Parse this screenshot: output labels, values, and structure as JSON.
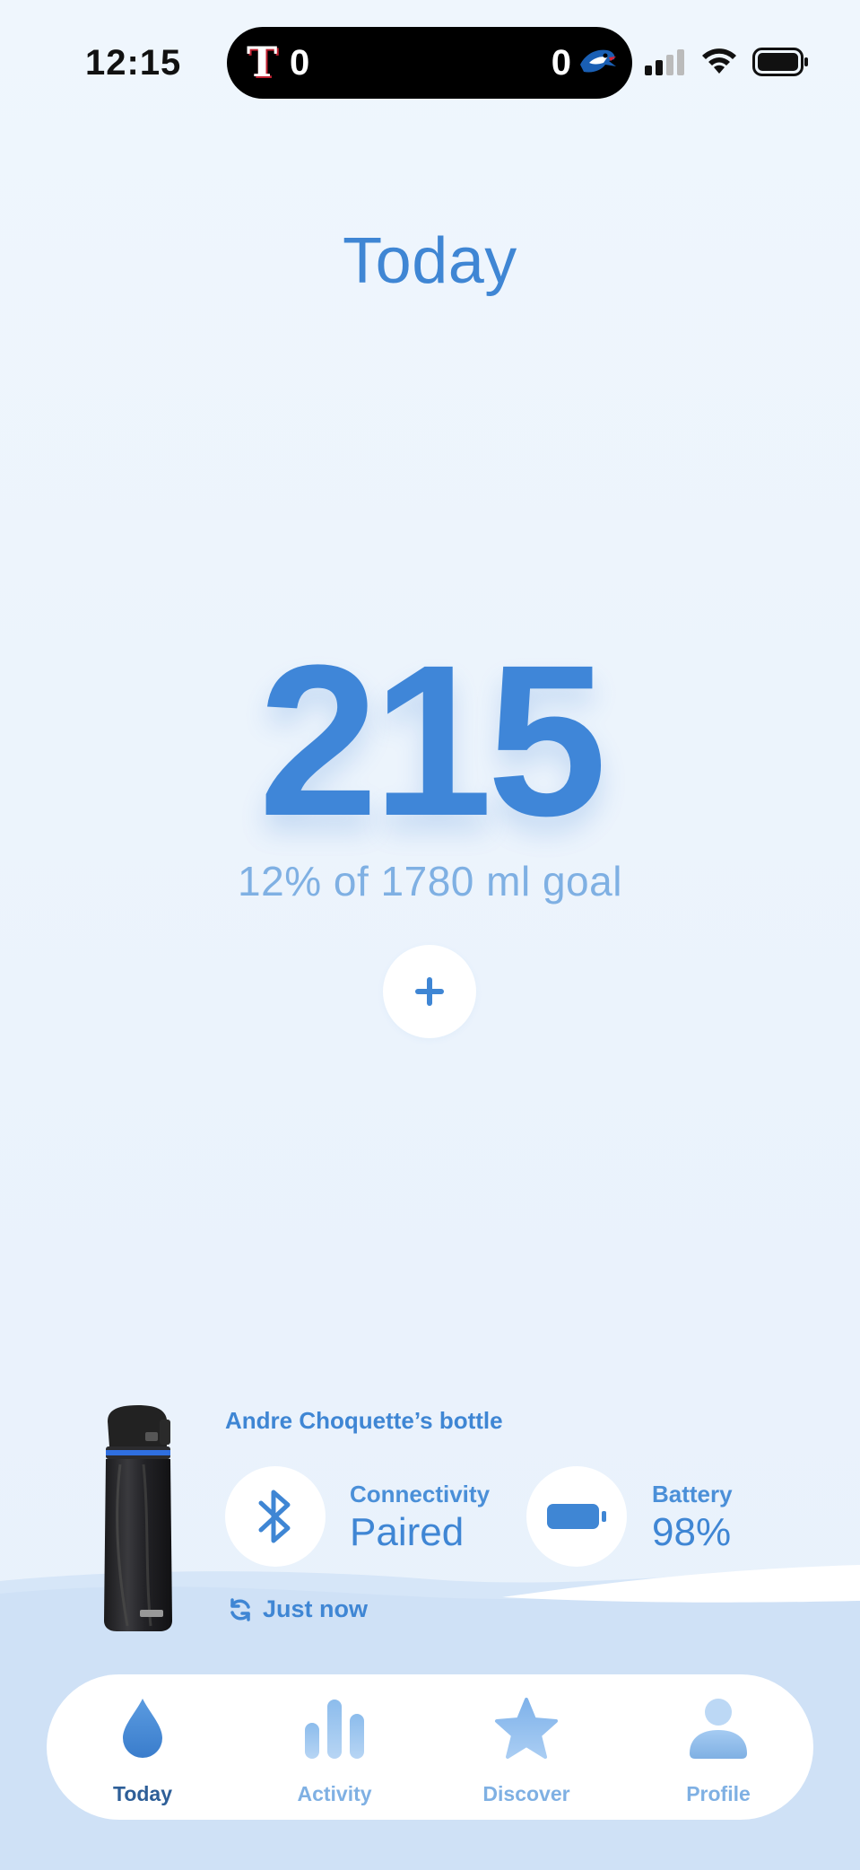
{
  "status_bar": {
    "time": "12:15",
    "live_activity": {
      "home_score": "0",
      "away_score": "0"
    }
  },
  "header": {
    "title": "Today"
  },
  "intake": {
    "value": "215",
    "goal_text": "12% of 1780 ml goal",
    "add_button_icon": "plus-icon"
  },
  "bottle": {
    "owner": "Andre Choquette’s bottle",
    "connectivity_label": "Connectivity",
    "connectivity_value": "Paired",
    "battery_label": "Battery",
    "battery_value": "98%",
    "sync_text": "Just now"
  },
  "tabs": [
    {
      "label": "Today",
      "icon": "water-drop-icon",
      "active": true
    },
    {
      "label": "Activity",
      "icon": "bar-chart-icon",
      "active": false
    },
    {
      "label": "Discover",
      "icon": "star-icon",
      "active": false
    },
    {
      "label": "Profile",
      "icon": "person-icon",
      "active": false
    }
  ],
  "colors": {
    "accent": "#3f86d4",
    "accent_light": "#7fb0e3",
    "active_tab": "#2e5f98",
    "background": "#eef5fd"
  }
}
